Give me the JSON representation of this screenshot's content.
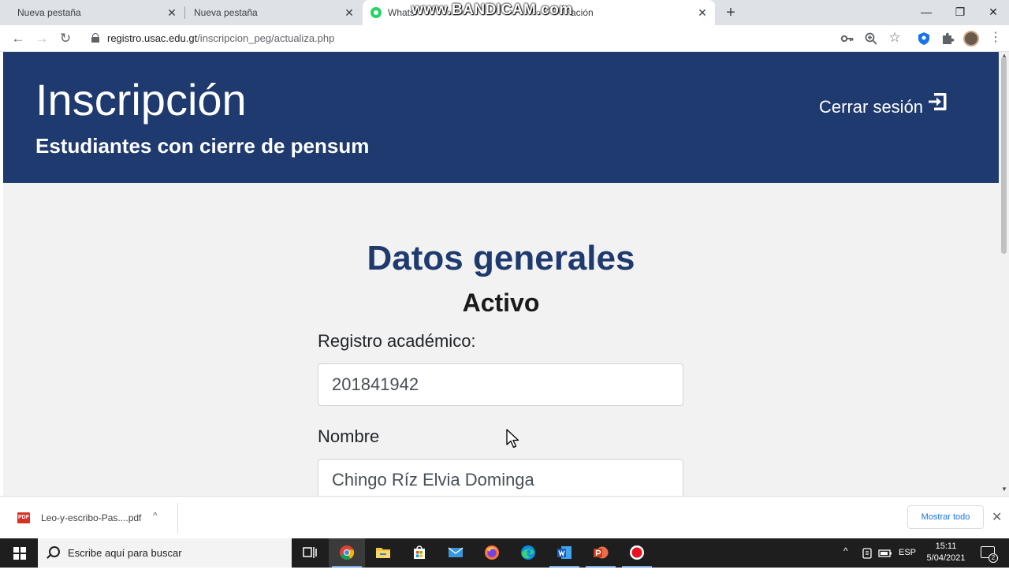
{
  "browser": {
    "tabs": [
      {
        "title": "Nueva pestaña",
        "close": "✕"
      },
      {
        "title": "Nueva pestaña",
        "close": "✕"
      },
      {
        "title": "Whats",
        "close": "✕"
      },
      {
        "title": "ación",
        "close": "✕"
      }
    ],
    "new_tab": "+",
    "window_controls": {
      "minimize": "—",
      "restore": "❐",
      "close": "✕"
    },
    "watermark": "www.BANDICAM.com",
    "nav": {
      "back": "←",
      "forward": "→",
      "reload": "↻"
    },
    "url_host": "registro.usac.edu.gt",
    "url_path": "/inscripcion_peg/actualiza.php",
    "toolbar_icons": [
      "key-icon",
      "zoom-icon",
      "star-icon",
      "shield-extension-icon",
      "puzzle-icon",
      "profile-avatar",
      "menu-icon"
    ],
    "menu_glyph": "⋮",
    "star_glyph": "☆"
  },
  "header": {
    "title": "Inscripción",
    "subtitle": "Estudiantes con cierre de pensum",
    "logout_label": "Cerrar sesión"
  },
  "main": {
    "section_title": "Datos generales",
    "status": "Activo",
    "fields": [
      {
        "label": "Registro académico:",
        "value": "201841942"
      },
      {
        "label": "Nombre",
        "value": "Chingo Ríz Elvia Dominga"
      }
    ]
  },
  "download_bar": {
    "file_type": "PDF",
    "file_name": "Leo-y-escribo-Pas....pdf",
    "chevron": "^",
    "show_all": "Mostrar todo",
    "close": "✕"
  },
  "taskbar": {
    "search_placeholder": "Escribe aquí para buscar",
    "language": "ESP",
    "time": "15:11",
    "date": "5/04/2021",
    "notification_count": "2",
    "tray_chevron": "^"
  },
  "colors": {
    "brand_navy": "#1e3a6e",
    "page_bg": "#f2f2f2",
    "link_blue": "#1a73e8"
  }
}
